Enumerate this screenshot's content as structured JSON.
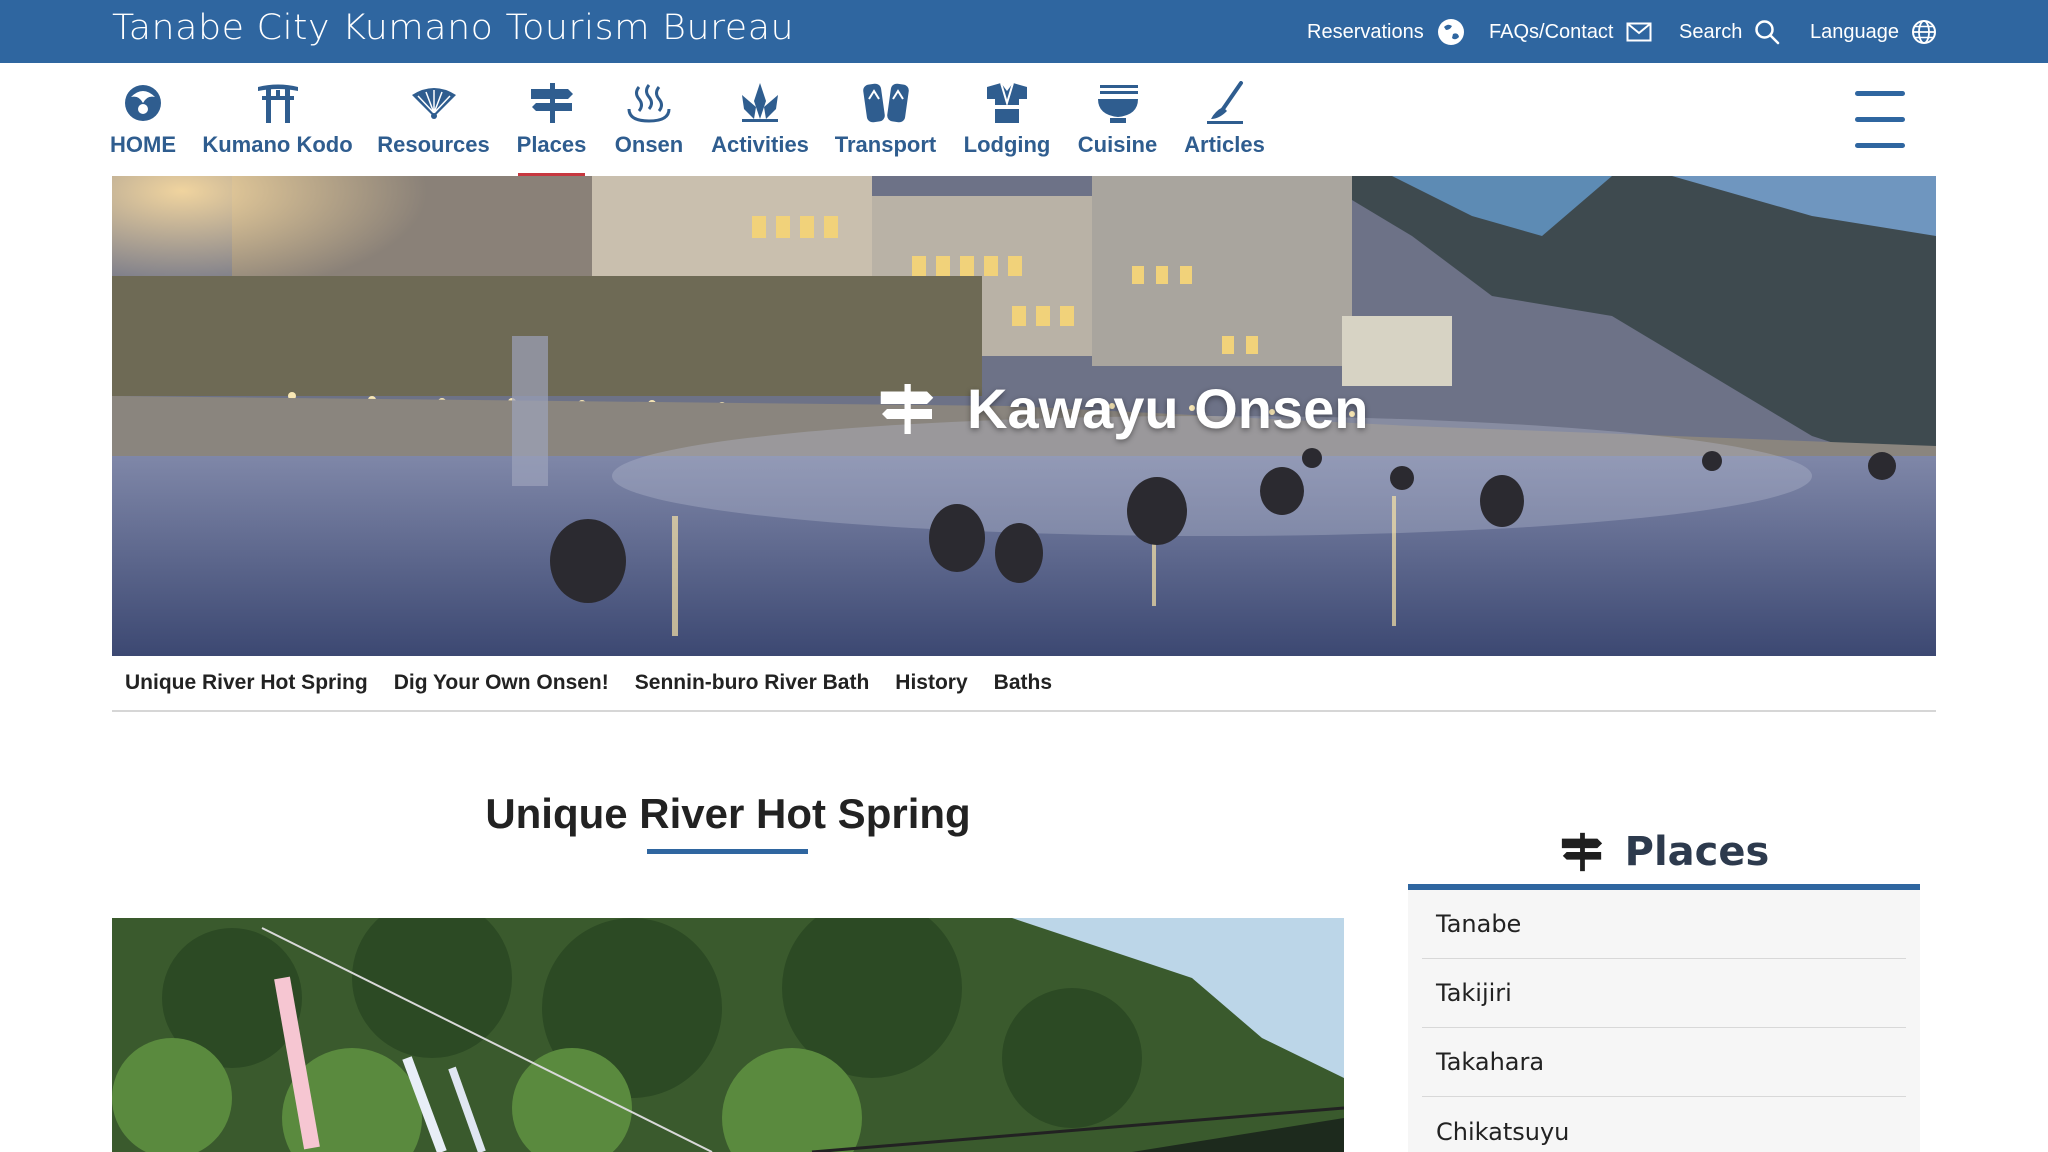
{
  "header": {
    "site_title": "Tanabe City Kumano Tourism Bureau",
    "utility": [
      {
        "label": "Reservations",
        "icon": "globe-hand-icon"
      },
      {
        "label": "FAQs/Contact",
        "icon": "envelope-icon"
      },
      {
        "label": "Search",
        "icon": "search-icon"
      },
      {
        "label": "Language",
        "icon": "globe-icon"
      }
    ],
    "brand_color": "#2f66a0"
  },
  "nav": {
    "items": [
      {
        "label": "HOME",
        "icon": "crow-icon"
      },
      {
        "label": "Kumano Kodo",
        "icon": "torii-icon"
      },
      {
        "label": "Resources",
        "icon": "fan-icon"
      },
      {
        "label": "Places",
        "icon": "signpost-icon"
      },
      {
        "label": "Onsen",
        "icon": "hot-spring-icon"
      },
      {
        "label": "Activities",
        "icon": "activities-icon"
      },
      {
        "label": "Transport",
        "icon": "sandals-icon"
      },
      {
        "label": "Lodging",
        "icon": "yukata-icon"
      },
      {
        "label": "Cuisine",
        "icon": "bowl-icon"
      },
      {
        "label": "Articles",
        "icon": "brush-icon"
      }
    ],
    "active": "Places",
    "active_color": "#c7373f"
  },
  "hero": {
    "title": "Kawayu Onsen",
    "icon": "signpost-icon"
  },
  "subnav": {
    "links": [
      "Unique River Hot Spring",
      "Dig Your Own Onsen!",
      "Sennin-buro River Bath",
      "History",
      "Baths"
    ]
  },
  "main": {
    "section_title": "Unique River Hot Spring"
  },
  "sidebar": {
    "title": "Places",
    "icon": "signpost-icon",
    "items": [
      "Tanabe",
      "Takijiri",
      "Takahara",
      "Chikatsuyu"
    ]
  }
}
